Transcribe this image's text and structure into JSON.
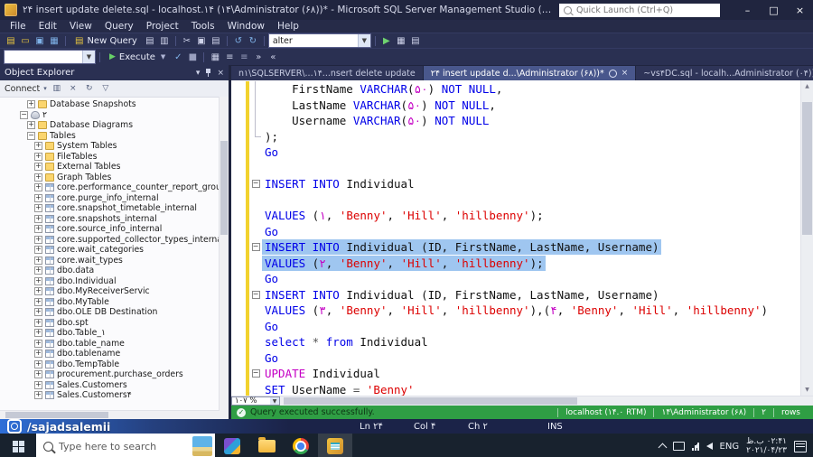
{
  "window": {
    "title": "۲۴ insert update delete.sql - localhost.۱۴ (۱۴\\Administrator (۶۸))* - Microsoft SQL Server Management Studio (Administrator)",
    "quick_launch": "Quick Launch (Ctrl+Q)"
  },
  "menu": [
    "File",
    "Edit",
    "View",
    "Query",
    "Project",
    "Tools",
    "Window",
    "Help"
  ],
  "toolbar": {
    "new_query_label": "New Query",
    "db_combo_value": "alter",
    "connection_combo_value": "",
    "execute_label": "Execute"
  },
  "object_explorer": {
    "title": "Object Explorer",
    "connect_label": "Connect",
    "tree": [
      {
        "lvl": 3,
        "exp": "+",
        "icon": "folder",
        "label": "Database Snapshots"
      },
      {
        "lvl": 2,
        "exp": "-",
        "icon": "db",
        "label": "۲"
      },
      {
        "lvl": 3,
        "exp": "+",
        "icon": "folder",
        "label": "Database Diagrams"
      },
      {
        "lvl": 3,
        "exp": "-",
        "icon": "folder",
        "label": "Tables"
      },
      {
        "lvl": 4,
        "exp": "+",
        "icon": "folder",
        "label": "System Tables"
      },
      {
        "lvl": 4,
        "exp": "+",
        "icon": "folder",
        "label": "FileTables"
      },
      {
        "lvl": 4,
        "exp": "+",
        "icon": "folder",
        "label": "External Tables"
      },
      {
        "lvl": 4,
        "exp": "+",
        "icon": "folder",
        "label": "Graph Tables"
      },
      {
        "lvl": 4,
        "exp": "+",
        "icon": "table",
        "label": "core.performance_counter_report_group_ite"
      },
      {
        "lvl": 4,
        "exp": "+",
        "icon": "table",
        "label": "core.purge_info_internal"
      },
      {
        "lvl": 4,
        "exp": "+",
        "icon": "table",
        "label": "core.snapshot_timetable_internal"
      },
      {
        "lvl": 4,
        "exp": "+",
        "icon": "table",
        "label": "core.snapshots_internal"
      },
      {
        "lvl": 4,
        "exp": "+",
        "icon": "table",
        "label": "core.source_info_internal"
      },
      {
        "lvl": 4,
        "exp": "+",
        "icon": "table",
        "label": "core.supported_collector_types_internal"
      },
      {
        "lvl": 4,
        "exp": "+",
        "icon": "table",
        "label": "core.wait_categories"
      },
      {
        "lvl": 4,
        "exp": "+",
        "icon": "table",
        "label": "core.wait_types"
      },
      {
        "lvl": 4,
        "exp": "+",
        "icon": "table",
        "label": "dbo.data"
      },
      {
        "lvl": 4,
        "exp": "+",
        "icon": "table",
        "label": "dbo.Individual"
      },
      {
        "lvl": 4,
        "exp": "+",
        "icon": "table",
        "label": "dbo.MyReceiverServic"
      },
      {
        "lvl": 4,
        "exp": "+",
        "icon": "table",
        "label": "dbo.MyTable"
      },
      {
        "lvl": 4,
        "exp": "+",
        "icon": "table",
        "label": "dbo.OLE DB Destination"
      },
      {
        "lvl": 4,
        "exp": "+",
        "icon": "table",
        "label": "dbo.spt"
      },
      {
        "lvl": 4,
        "exp": "+",
        "icon": "table",
        "label": "dbo.Table_۱"
      },
      {
        "lvl": 4,
        "exp": "+",
        "icon": "table",
        "label": "dbo.table_name"
      },
      {
        "lvl": 4,
        "exp": "+",
        "icon": "table",
        "label": "dbo.tablename"
      },
      {
        "lvl": 4,
        "exp": "+",
        "icon": "table",
        "label": "dbo.TempTable"
      },
      {
        "lvl": 4,
        "exp": "+",
        "icon": "table",
        "label": "procurement.purchase_orders"
      },
      {
        "lvl": 4,
        "exp": "+",
        "icon": "table",
        "label": "Sales.Customers"
      },
      {
        "lvl": 4,
        "exp": "+",
        "icon": "table",
        "label": "Sales.Customers۴"
      }
    ]
  },
  "tabs": [
    {
      "label": "n۱\\SQLSERVER\\...۱۴...nsert delete update",
      "active": false
    },
    {
      "label": "۲۴ insert update d...\\Administrator (۶۸))*",
      "active": true
    },
    {
      "label": "~vs۴DC.sql - localh...Administrator (۰۴))",
      "active": false
    }
  ],
  "editor": {
    "zoom": "۱۰۷ %",
    "lines": [
      {
        "guide": "v",
        "seg": [
          [
            "p",
            "    FirstName "
          ],
          [
            "k",
            "VARCHAR"
          ],
          [
            "p",
            "("
          ],
          [
            "n",
            "۵۰"
          ],
          [
            "p",
            ") "
          ],
          [
            "k",
            "NOT NULL"
          ],
          [
            "p",
            ","
          ]
        ]
      },
      {
        "guide": "v",
        "seg": [
          [
            "p",
            "    LastName "
          ],
          [
            "k",
            "VARCHAR"
          ],
          [
            "p",
            "("
          ],
          [
            "n",
            "۵۰"
          ],
          [
            "p",
            ") "
          ],
          [
            "k",
            "NOT NULL"
          ],
          [
            "p",
            ","
          ]
        ]
      },
      {
        "guide": "v",
        "seg": [
          [
            "p",
            "    Username "
          ],
          [
            "k",
            "VARCHAR"
          ],
          [
            "p",
            "("
          ],
          [
            "n",
            "۵۰"
          ],
          [
            "p",
            ") "
          ],
          [
            "k",
            "NOT NULL"
          ]
        ]
      },
      {
        "guide": "e",
        "seg": [
          [
            "p",
            ");"
          ]
        ]
      },
      {
        "seg": [
          [
            "k",
            "Go"
          ]
        ]
      },
      {
        "seg": []
      },
      {
        "fold": "-",
        "seg": [
          [
            "k",
            "INSERT INTO"
          ],
          [
            "p",
            " Individual"
          ]
        ]
      },
      {
        "seg": []
      },
      {
        "seg": [
          [
            "k",
            "VALUES"
          ],
          [
            "p",
            " ("
          ],
          [
            "n",
            "۱"
          ],
          [
            "p",
            ", "
          ],
          [
            "s",
            "'Benny'"
          ],
          [
            "p",
            ", "
          ],
          [
            "s",
            "'Hill'"
          ],
          [
            "p",
            ", "
          ],
          [
            "s",
            "'hillbenny'"
          ],
          [
            "p",
            ");"
          ]
        ]
      },
      {
        "seg": [
          [
            "k",
            "Go"
          ]
        ]
      },
      {
        "fold": "-",
        "sel": true,
        "seg": [
          [
            "k",
            "INSERT INTO"
          ],
          [
            "p",
            " Individual (ID, FirstName, LastName, Username)"
          ]
        ]
      },
      {
        "sel": true,
        "seg": [
          [
            "k",
            "VALUES"
          ],
          [
            "p",
            " ("
          ],
          [
            "n",
            "۲"
          ],
          [
            "p",
            ", "
          ],
          [
            "s",
            "'Benny'"
          ],
          [
            "p",
            ", "
          ],
          [
            "s",
            "'Hill'"
          ],
          [
            "p",
            ", "
          ],
          [
            "s",
            "'hillbenny'"
          ],
          [
            "p",
            ");"
          ]
        ]
      },
      {
        "seg": [
          [
            "k",
            "Go"
          ]
        ]
      },
      {
        "fold": "-",
        "seg": [
          [
            "k",
            "INSERT INTO"
          ],
          [
            "p",
            " Individual (ID, FirstName, LastName, Username)"
          ]
        ]
      },
      {
        "seg": [
          [
            "k",
            "VALUES"
          ],
          [
            "p",
            " ("
          ],
          [
            "n",
            "۳"
          ],
          [
            "p",
            ", "
          ],
          [
            "s",
            "'Benny'"
          ],
          [
            "p",
            ", "
          ],
          [
            "s",
            "'Hill'"
          ],
          [
            "p",
            ", "
          ],
          [
            "s",
            "'hillbenny'"
          ],
          [
            "p",
            "),("
          ],
          [
            "n",
            "۴"
          ],
          [
            "p",
            ", "
          ],
          [
            "s",
            "'Benny'"
          ],
          [
            "p",
            ", "
          ],
          [
            "s",
            "'Hill'"
          ],
          [
            "p",
            ", "
          ],
          [
            "s",
            "'hillbenny'"
          ],
          [
            "p",
            ")"
          ]
        ]
      },
      {
        "seg": [
          [
            "k",
            "Go"
          ]
        ]
      },
      {
        "seg": [
          [
            "k",
            "select"
          ],
          [
            "o",
            " * "
          ],
          [
            "k",
            "from"
          ],
          [
            "p",
            " Individual"
          ]
        ]
      },
      {
        "seg": [
          [
            "k",
            "Go"
          ]
        ]
      },
      {
        "fold": "-",
        "seg": [
          [
            "m",
            "UPDATE"
          ],
          [
            "p",
            " Individual"
          ]
        ]
      },
      {
        "seg": [
          [
            "k",
            "SET"
          ],
          [
            "p",
            " UserName "
          ],
          [
            "o",
            "= "
          ],
          [
            "s",
            "'Benny'"
          ]
        ]
      }
    ]
  },
  "status": {
    "message": "Query executed successfully.",
    "segments": [
      "localhost (۱۴.۰ RTM)",
      "۱۴\\Administrator (۶۸)",
      "۲",
      "rows"
    ]
  },
  "statusbar2": {
    "ln": "Ln ۲۴",
    "col": "Col ۴",
    "ch": "Ch ۲",
    "mode": "INS"
  },
  "watermark": "/sajadsalemii",
  "taskbar": {
    "search_placeholder": "Type here to search",
    "apps": [
      "media",
      "file-explorer",
      "chrome",
      "ssms"
    ],
    "tray": {
      "lang": "ENG",
      "time": "۰۲:۴۱ ب.ظ",
      "date": "۲۰۲۱/۰۴/۲۳"
    }
  }
}
